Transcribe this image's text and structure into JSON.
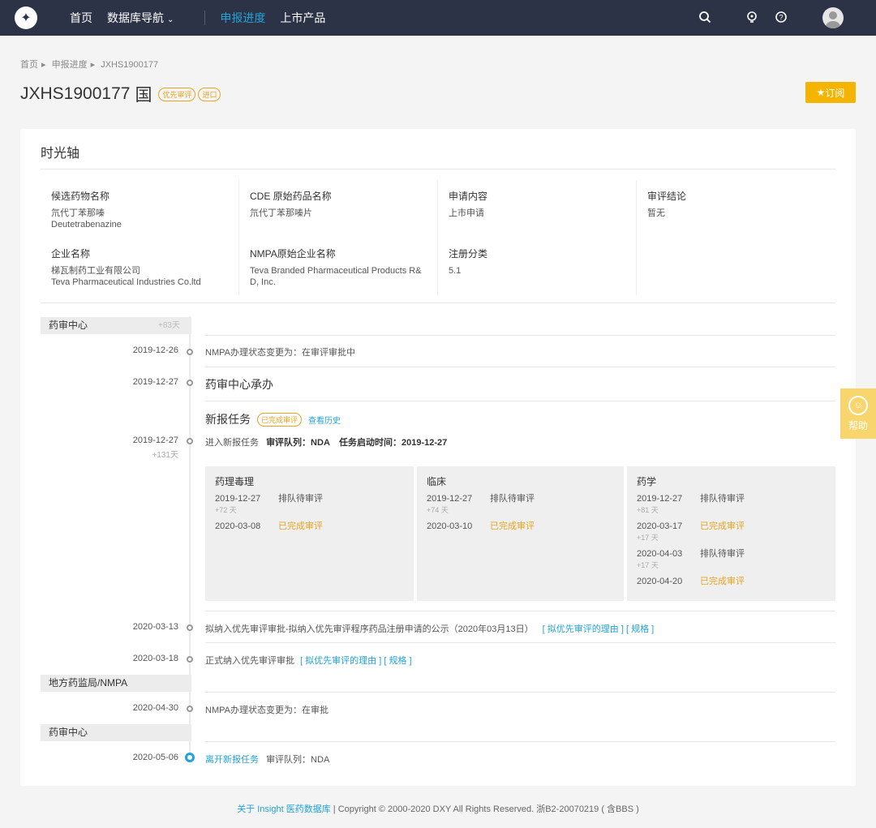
{
  "nav": {
    "home": "首页",
    "db_nav": "数据库导航",
    "progress": "申报进度",
    "products": "上市产品"
  },
  "breadcrumb": [
    "首页",
    "申报进度",
    "JXHS1900177"
  ],
  "header": {
    "code": "JXHS1900177",
    "flag": "国",
    "badge1": "优先审评",
    "badge2": "进口",
    "subscribe": "订阅"
  },
  "timeline_title": "时光轴",
  "info": [
    {
      "label": "候选药物名称",
      "value_lines": [
        "氘代丁苯那嗪",
        "Deutetrabenazine"
      ]
    },
    {
      "label": "CDE 原始药品名称",
      "value_lines": [
        "氘代丁苯那嗪片"
      ]
    },
    {
      "label": "申请内容",
      "value_lines": [
        "上市申请"
      ]
    },
    {
      "label": "审评结论",
      "value_lines": [
        "暂无"
      ]
    },
    {
      "label": "企业名称",
      "value_lines": [
        "梯瓦制药工业有限公司",
        "Teva Pharmaceutical Industries Co.ltd"
      ]
    },
    {
      "label": "NMPA原始企业名称",
      "value_lines": [
        "Teva Branded Pharmaceutical Products R&",
        "D, Inc."
      ]
    },
    {
      "label": "注册分类",
      "value_lines": [
        "5.1"
      ]
    }
  ],
  "sections": [
    {
      "name": "药审中心",
      "count": "+83天"
    },
    {
      "name": "地方药监局/NMPA",
      "count": ""
    },
    {
      "name": "药审中心",
      "count": ""
    }
  ],
  "events": {
    "e1": {
      "date": "2019-12-26",
      "text": "NMPA办理状态变更为：在审评审批中"
    },
    "e2": {
      "date": "2019-12-27",
      "text": "药审中心承办"
    },
    "task": {
      "title": "新报任务",
      "status": "已完成审评",
      "history": "查看历史",
      "date": "2019-12-27",
      "diff": "+131天",
      "text1": "进入新报任务",
      "queue_label": "审评队列：NDA",
      "start_label": "任务启动时间：2019-12-27"
    },
    "e4": {
      "date": "2020-03-13",
      "text": "拟纳入优先审评审批-拟纳入优先审评程序药品注册申请的公示（2020年03月13日）",
      "link1": "[ 拟优先审评的理由 ]",
      "link2": "[ 规格 ]"
    },
    "e5": {
      "date": "2020-03-18",
      "text": "正式纳入优先审评审批",
      "link1": "[ 拟优先审评的理由 ]",
      "link2": "[ 规格 ]"
    },
    "e6": {
      "date": "2020-04-30",
      "text": "NMPA办理状态变更为：在审批"
    },
    "e7": {
      "date": "2020-05-06",
      "link": "离开新报任务",
      "text": "审评队列：NDA"
    }
  },
  "boxes": [
    {
      "title": "药理毒理",
      "rows": [
        {
          "date": "2019-12-27",
          "status": "排队待审评",
          "done": false,
          "gap": "+72 天"
        },
        {
          "date": "2020-03-08",
          "status": "已完成审评",
          "done": true,
          "gap": ""
        }
      ]
    },
    {
      "title": "临床",
      "rows": [
        {
          "date": "2019-12-27",
          "status": "排队待审评",
          "done": false,
          "gap": "+74 天"
        },
        {
          "date": "2020-03-10",
          "status": "已完成审评",
          "done": true,
          "gap": ""
        }
      ]
    },
    {
      "title": "药学",
      "rows": [
        {
          "date": "2019-12-27",
          "status": "排队待审评",
          "done": false,
          "gap": "+81 天"
        },
        {
          "date": "2020-03-17",
          "status": "已完成审评",
          "done": true,
          "gap": "+17 天"
        },
        {
          "date": "2020-04-03",
          "status": "排队待审评",
          "done": false,
          "gap": "+17 天"
        },
        {
          "date": "2020-04-20",
          "status": "已完成审评",
          "done": true,
          "gap": ""
        }
      ]
    }
  ],
  "help": "帮助",
  "footer": {
    "about": "关于 Insight 医药数据库",
    "copy": "| Copyright © 2000-2020 DXY All Rights Reserved. 浙B2-20070219 ( 含BBS )"
  },
  "colors": {
    "accent": "#22a3d6",
    "topbar": "#2d3347",
    "done": "#e6a521",
    "subscribe": "#f5b400"
  }
}
